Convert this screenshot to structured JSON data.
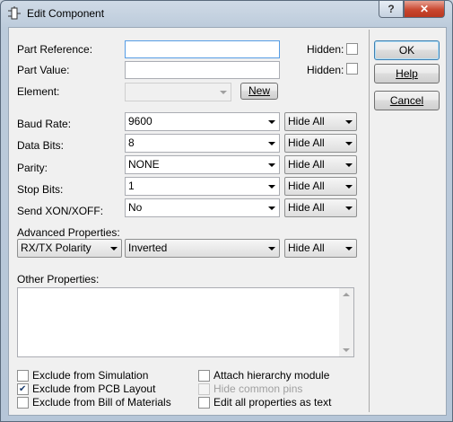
{
  "window": {
    "title": "Edit Component",
    "help_caption": "?",
    "close_caption": "✕"
  },
  "fields": {
    "part_reference": {
      "label": "Part Reference:",
      "value": "",
      "hidden_label": "Hidden:",
      "hidden": false
    },
    "part_value": {
      "label": "Part Value:",
      "value": "",
      "hidden_label": "Hidden:",
      "hidden": false
    },
    "element": {
      "label": "Element:",
      "value": "",
      "new_label": "New"
    }
  },
  "properties": [
    {
      "label": "Baud Rate:",
      "value": "9600",
      "visibility": "Hide All"
    },
    {
      "label": "Data Bits:",
      "value": "8",
      "visibility": "Hide All"
    },
    {
      "label": "Parity:",
      "value": "NONE",
      "visibility": "Hide All"
    },
    {
      "label": "Stop Bits:",
      "value": "1",
      "visibility": "Hide All"
    },
    {
      "label": "Send XON/XOFF:",
      "value": "No",
      "visibility": "Hide All"
    }
  ],
  "advanced": {
    "label": "Advanced Properties:",
    "property": "RX/TX Polarity",
    "value": "Inverted",
    "visibility": "Hide All"
  },
  "other_properties": {
    "label": "Other Properties:",
    "text": ""
  },
  "options": {
    "exclude_simulation": {
      "label": "Exclude from Simulation",
      "checked": false
    },
    "exclude_pcb": {
      "label": "Exclude from PCB Layout",
      "checked": true
    },
    "exclude_bom": {
      "label": "Exclude from Bill of Materials",
      "checked": false
    },
    "attach_hierarchy": {
      "label": "Attach hierarchy module",
      "checked": false
    },
    "hide_common_pins": {
      "label": "Hide common pins",
      "checked": false,
      "disabled": true
    },
    "edit_as_text": {
      "label": "Edit all properties as text",
      "checked": false
    }
  },
  "buttons": {
    "ok": "OK",
    "help": "Help",
    "cancel": "Cancel"
  }
}
